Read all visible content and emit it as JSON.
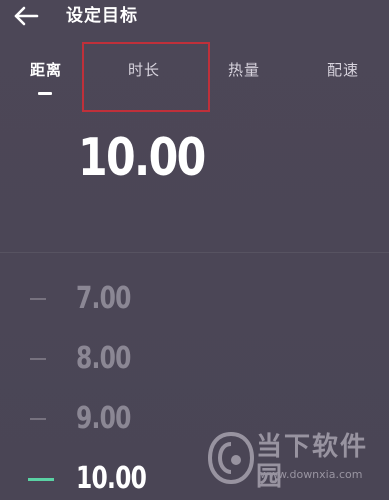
{
  "header": {
    "title": "设定目标",
    "back_icon": "arrow-left-icon"
  },
  "tabs": [
    {
      "label": "距离",
      "active": true
    },
    {
      "label": "时长",
      "active": false,
      "highlighted": true
    },
    {
      "label": "热量",
      "active": false
    },
    {
      "label": "配速",
      "active": false
    }
  ],
  "current_value": "10.00",
  "picker": {
    "items": [
      {
        "label": "7.00",
        "selected": false
      },
      {
        "label": "8.00",
        "selected": false
      },
      {
        "label": "9.00",
        "selected": false
      },
      {
        "label": "10.00",
        "selected": true
      }
    ]
  },
  "watermark": {
    "name": "当下软件园",
    "url": "www.downxia.com"
  },
  "colors": {
    "background": "#4c4757",
    "highlight_box": "#c0303a",
    "selected_tick": "#5ad2a4"
  }
}
